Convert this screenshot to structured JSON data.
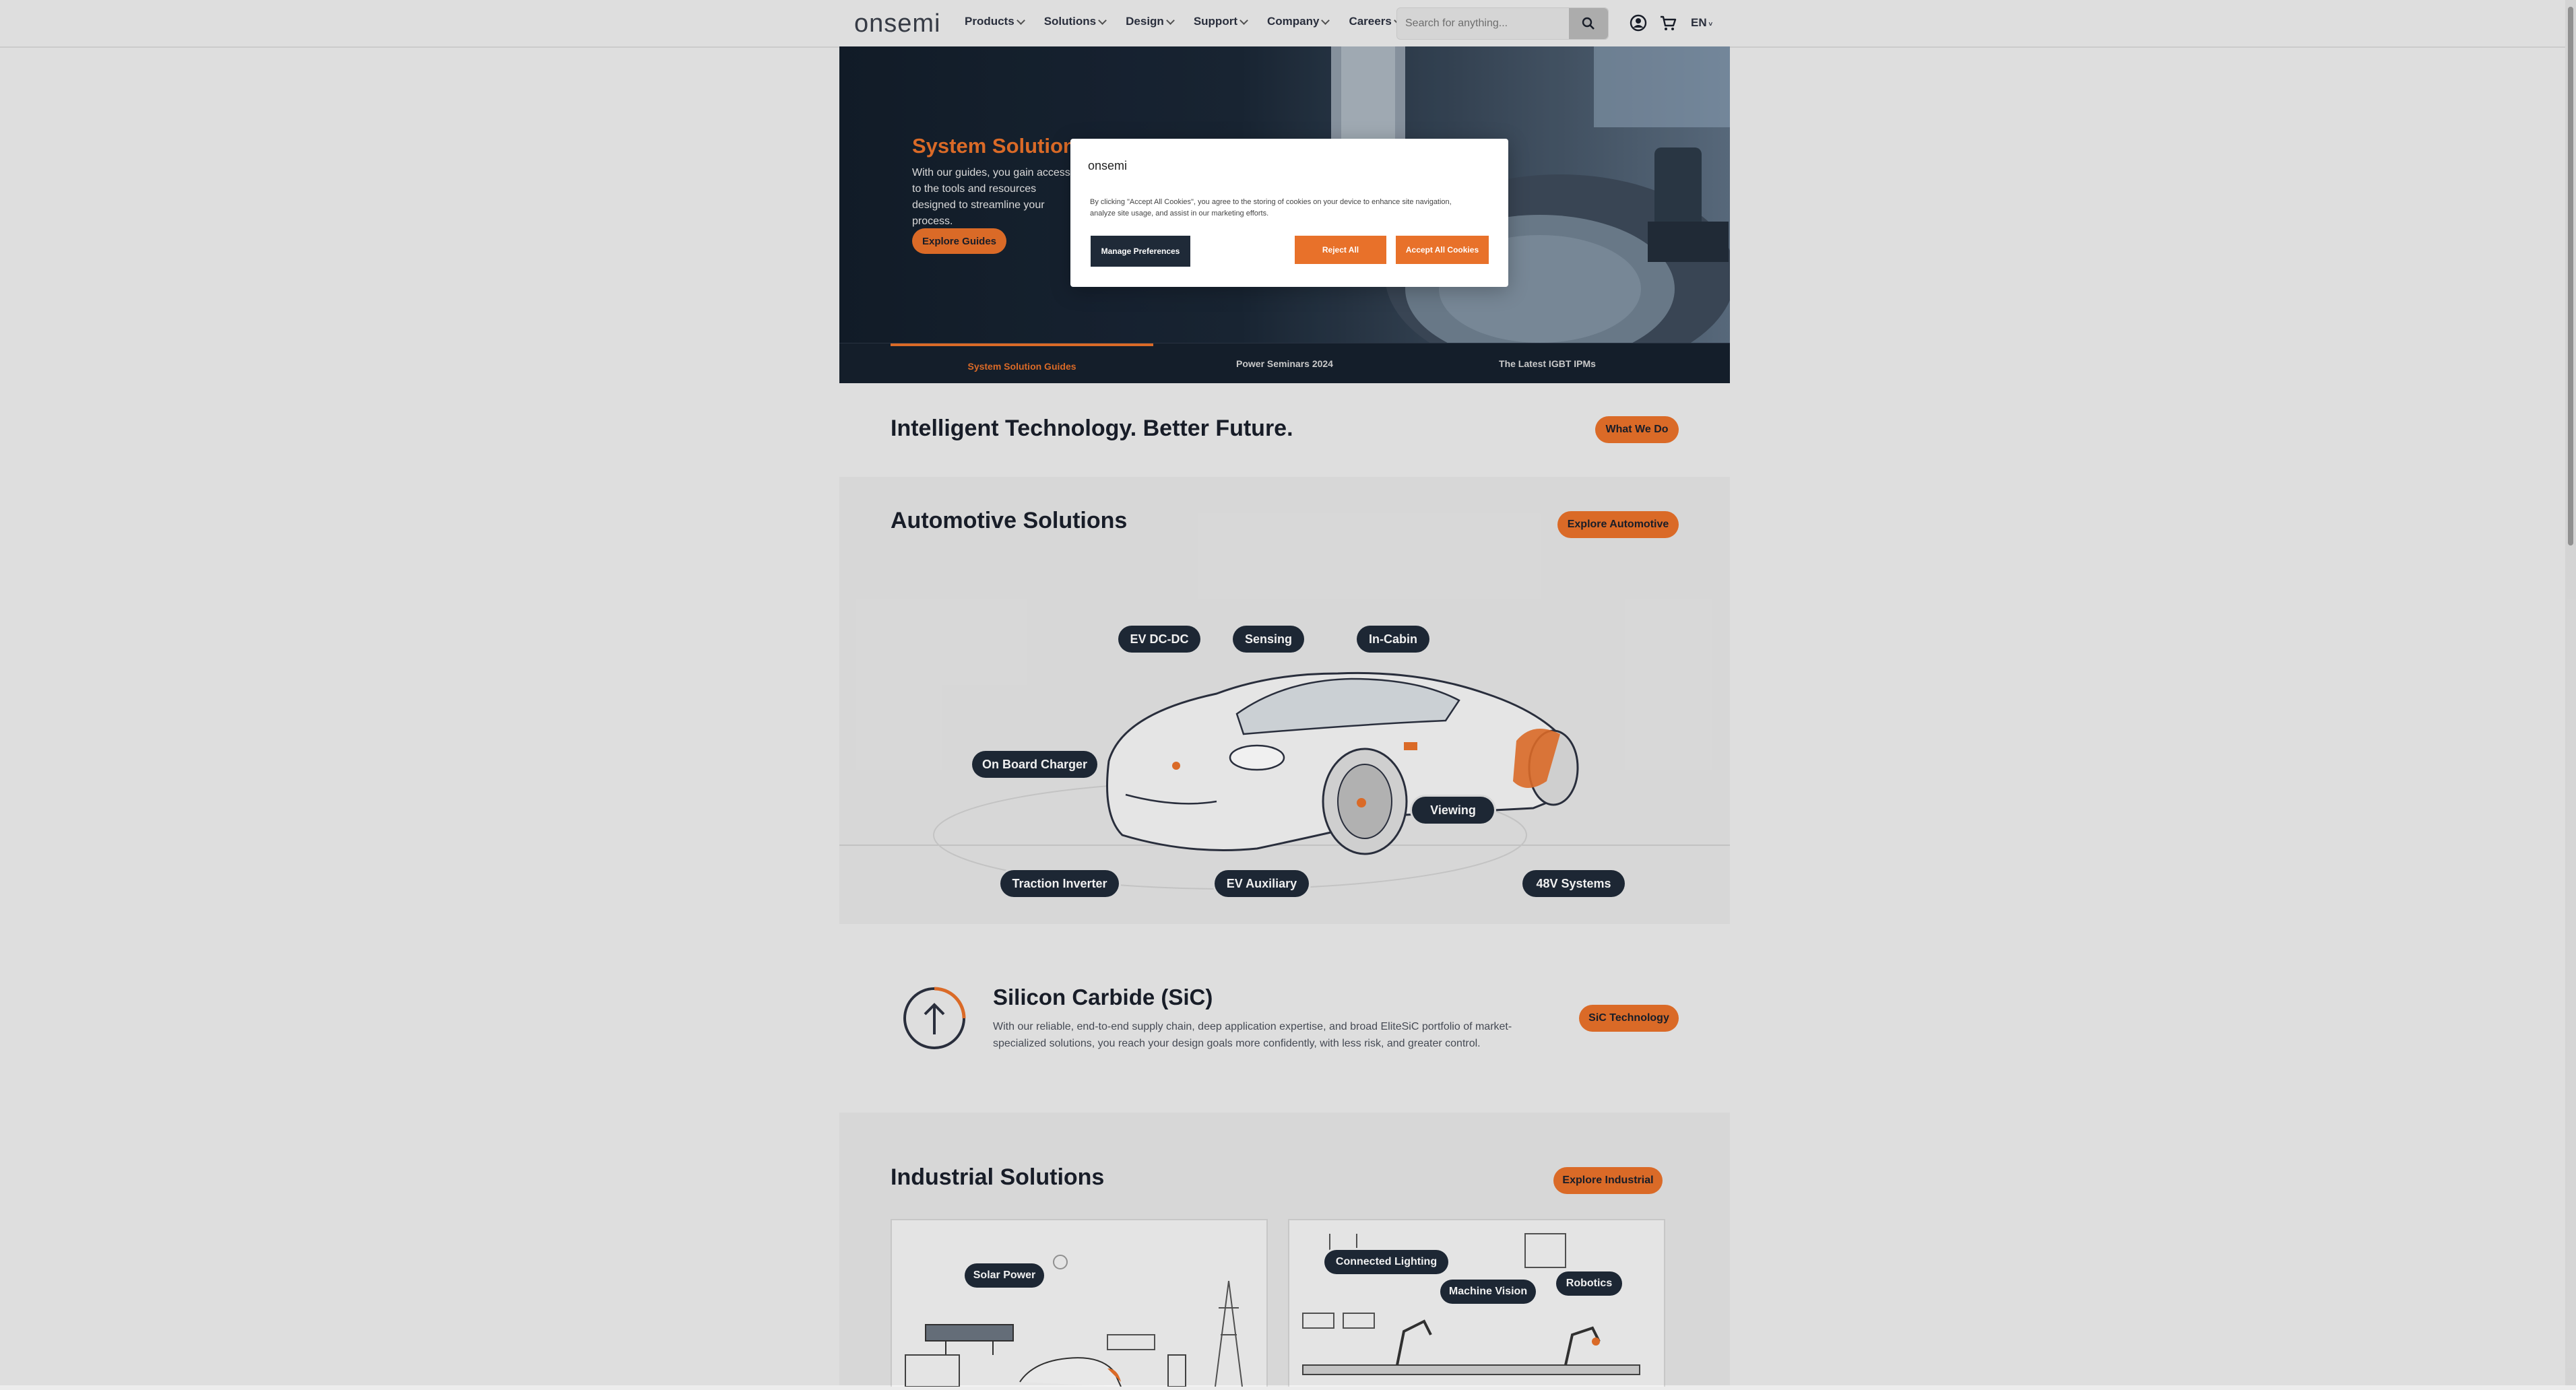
{
  "header": {
    "logo": "onsemi",
    "nav": [
      {
        "label": "Products"
      },
      {
        "label": "Solutions"
      },
      {
        "label": "Design"
      },
      {
        "label": "Support"
      },
      {
        "label": "Company"
      },
      {
        "label": "Careers"
      }
    ],
    "search_placeholder": "Search for anything...",
    "language": "EN"
  },
  "hero": {
    "title": "System Solution",
    "description": "With our guides, you gain access to the tools and resources designed to streamline your process.",
    "button": "Explore Guides",
    "tabs": [
      {
        "label": "System Solution Guides",
        "active": true
      },
      {
        "label": "Power Seminars 2024",
        "active": false
      },
      {
        "label": "The Latest IGBT IPMs",
        "active": false
      }
    ]
  },
  "intro": {
    "title": "Intelligent Technology. Better Future.",
    "button": "What We Do"
  },
  "automotive": {
    "title": "Automotive Solutions",
    "button": "Explore Automotive",
    "pills": [
      "EV DC-DC",
      "Sensing",
      "In-Cabin",
      "On Board Charger",
      "Viewing",
      "Traction Inverter",
      "EV Auxiliary",
      "48V Systems"
    ]
  },
  "sic": {
    "title": "Silicon Carbide (SiC)",
    "description": "With our reliable, end-to-end supply chain, deep application expertise, and broad EliteSiC portfolio of market-specialized solutions, you reach your design goals more confidently, with less risk, and greater control.",
    "button": "SiC Technology"
  },
  "industrial": {
    "title": "Industrial Solutions",
    "button": "Explore Industrial",
    "pills": [
      "Solar Power",
      "Connected Lighting",
      "Machine Vision",
      "Robotics"
    ]
  },
  "cookie_modal": {
    "logo": "onsemi",
    "text": "By clicking \"Accept All Cookies\", you agree to the storing of cookies on your device to enhance site navigation, analyze site usage, and assist in our marketing efforts.",
    "manage": "Manage Preferences",
    "reject": "Reject All",
    "accept": "Accept All Cookies"
  },
  "colors": {
    "accent": "#e8712a",
    "navy": "#1f2a38",
    "page_bg": "#ececec"
  }
}
